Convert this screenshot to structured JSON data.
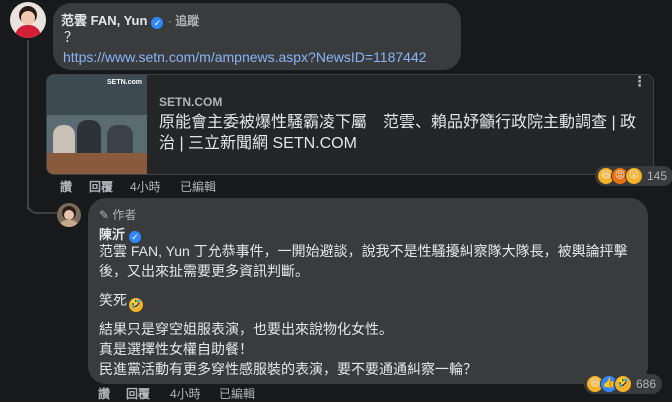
{
  "top_comment": {
    "author": "范雲 FAN, Yun",
    "follow": "追蹤",
    "text": "？",
    "url": "https://www.setn.com/m/ampnews.aspx?NewsID=1187442"
  },
  "link_preview": {
    "site": "SETN.COM",
    "title": "原能會主委被爆性騷霸凌下屬　范雲、賴品妤籲行政院主動調查 | 政治 | 三立新聞網 SETN.COM",
    "thumb_brand": "SETN.com"
  },
  "top_actions": {
    "like": "讚",
    "reply": "回覆",
    "time": "4小時",
    "edited": "已編輯",
    "reaction_count": "145"
  },
  "reply": {
    "badge": "作者",
    "author": "陳沂",
    "paragraph1": "范雲 FAN, Yun 丁允恭事件，一開始避談，說我不是性騷擾糾察隊大隊長，被輿論抨擊後，又出來扯需要更多資訊判斷。",
    "laugh": "笑死",
    "line1": "結果只是穿空姐服表演，也要出來說物化女性。",
    "line2": "真是選擇性女權自助餐！",
    "line3": "民進黨活動有更多穿性感服裝的表演，要不要通通糾察一輪？"
  },
  "reply_actions": {
    "like": "讚",
    "reply": "回覆",
    "time": "4小時",
    "edited": "已編輯",
    "reaction_count": "686"
  },
  "colors": {
    "background": "#18191a",
    "bubble": "#3a3b3c",
    "link": "#8ab4f8",
    "verified": "#2d88ff"
  }
}
